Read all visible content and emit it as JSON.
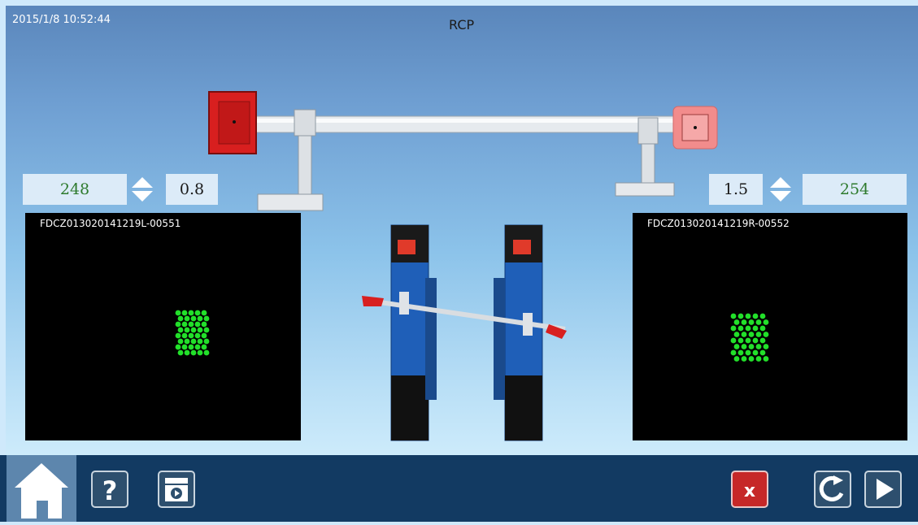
{
  "header": {
    "timestamp": "2015/1/8 10:52:44",
    "title": "RCP"
  },
  "left_panel": {
    "main_value": "248",
    "secondary_value": "0.8",
    "camera_label": "FDCZ013020141219L-00551"
  },
  "right_panel": {
    "secondary_value": "1.5",
    "main_value": "254",
    "camera_label": "FDCZ013020141219R-00552"
  },
  "colors": {
    "accent_green": "#2d7a2d",
    "target_dot_green": "#22e02a",
    "toolbar_bg": "#123a62",
    "target_red": "#e02a2a",
    "close_red": "#c62828"
  },
  "toolbar": {
    "home_icon": "home-icon",
    "help_icon": "help-icon",
    "video_icon": "video-icon",
    "close_icon": "close-icon",
    "back_icon": "back-icon",
    "next_icon": "next-icon"
  }
}
